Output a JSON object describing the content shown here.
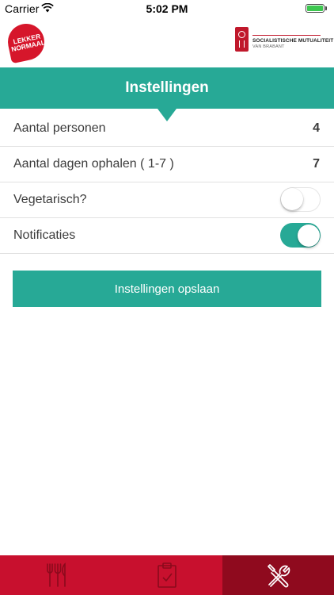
{
  "status_bar": {
    "carrier": "Carrier",
    "time": "5:02 PM",
    "battery_level": 1.0
  },
  "header": {
    "logo_left": {
      "line1": "LEKKER",
      "line2": "NORMAAL"
    },
    "logo_right": {
      "line1": "SOCIALISTISCHE MUTUALITEIT",
      "line2": "VAN BRABANT"
    }
  },
  "title": "Instellingen",
  "settings": [
    {
      "label": "Aantal personen",
      "value": "4"
    },
    {
      "label": "Aantal dagen ophalen ( 1-7 )",
      "value": "7"
    },
    {
      "label": "Vegetarisch?",
      "toggle": false
    },
    {
      "label": "Notificaties",
      "toggle": true
    }
  ],
  "save_button": {
    "label": "Instellingen opslaan"
  },
  "tabs": [
    {
      "icon": "fork-knife-icon",
      "active": false
    },
    {
      "icon": "clipboard-check-icon",
      "active": false
    },
    {
      "icon": "tools-icon",
      "active": true
    }
  ],
  "colors": {
    "accent": "#27a996",
    "brand_red": "#c8102e",
    "active_tab": "#8f0a1e"
  }
}
